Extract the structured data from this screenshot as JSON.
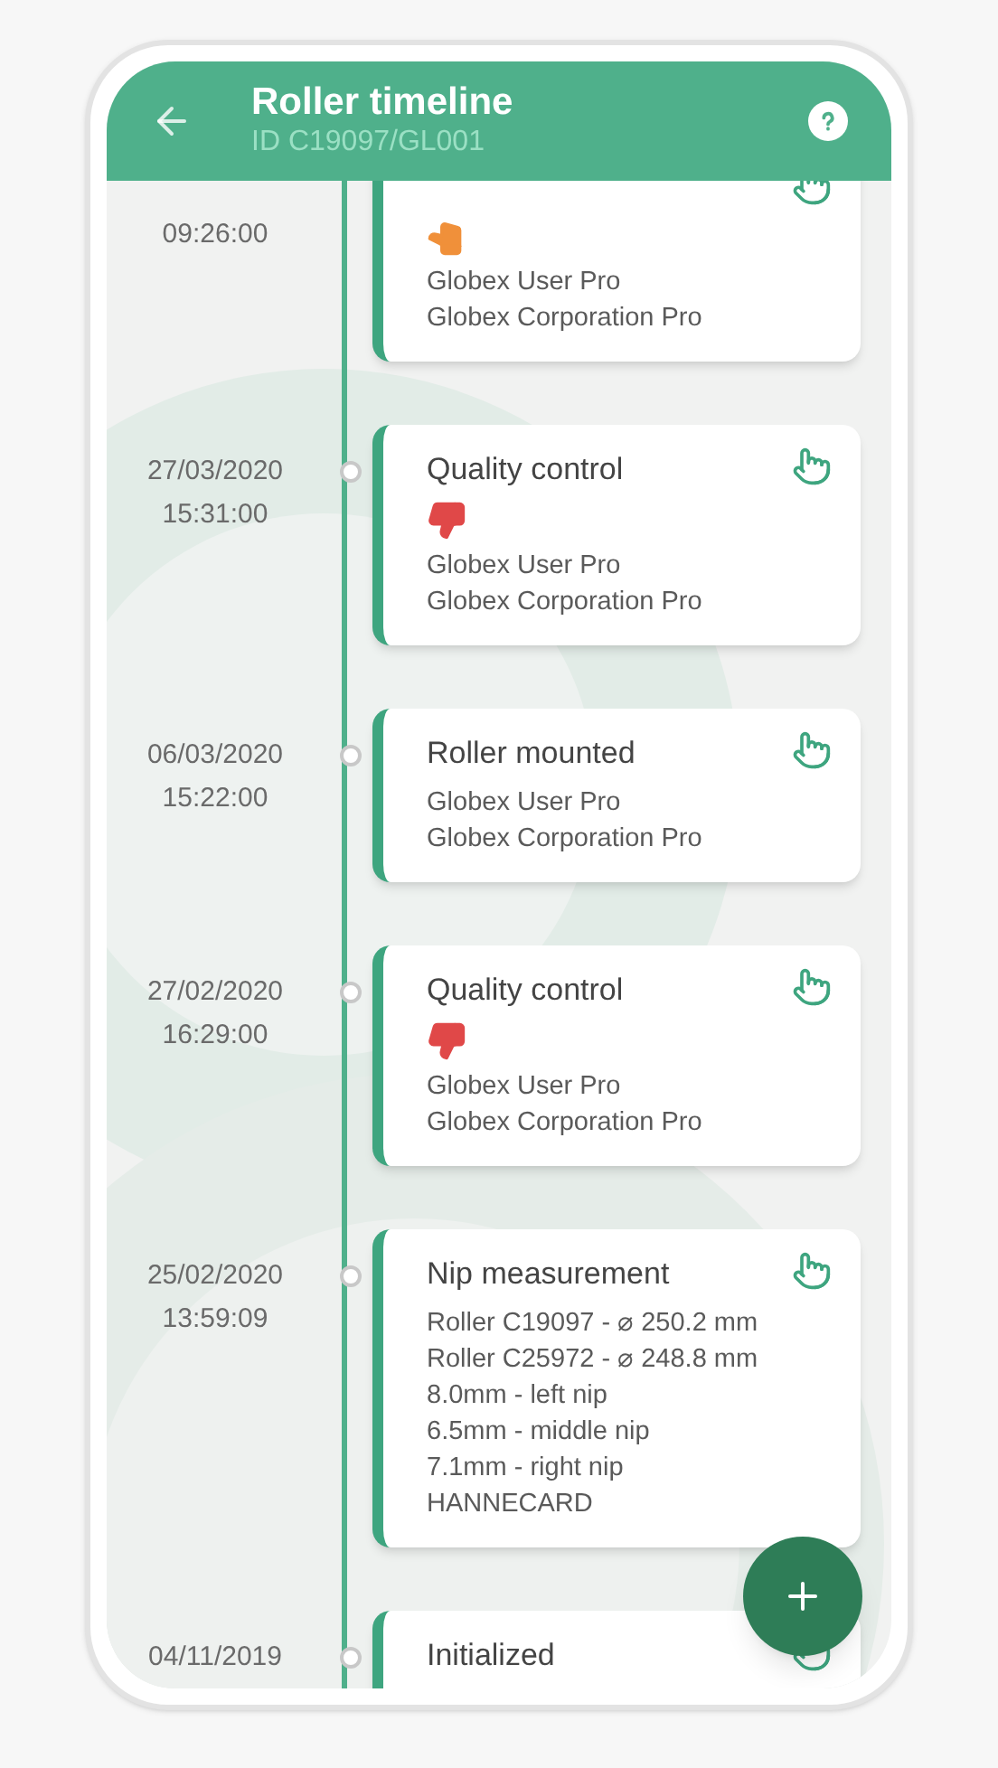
{
  "header": {
    "title": "Roller timeline",
    "subtitle": "ID C19097/GL001"
  },
  "events": [
    {
      "kind": "warning",
      "time": "09:26:00",
      "lines": [
        "Globex User Pro",
        "Globex Corporation Pro"
      ]
    },
    {
      "kind": "failed",
      "date": "27/03/2020",
      "time": "15:31:00",
      "title": "Quality control",
      "lines": [
        "Globex User Pro",
        "Globex Corporation Pro"
      ]
    },
    {
      "kind": "plain",
      "date": "06/03/2020",
      "time": "15:22:00",
      "title": "Roller mounted",
      "lines": [
        "Globex User Pro",
        "Globex Corporation Pro"
      ]
    },
    {
      "kind": "failed",
      "date": "27/02/2020",
      "time": "16:29:00",
      "title": "Quality control",
      "lines": [
        "Globex User Pro",
        "Globex Corporation Pro"
      ]
    },
    {
      "kind": "plain",
      "date": "25/02/2020",
      "time": "13:59:09",
      "title": "Nip measurement",
      "lines": [
        "Roller C19097 - ⌀ 250.2 mm",
        "Roller C25972 - ⌀ 248.8 mm",
        "8.0mm - left nip",
        "6.5mm - middle nip",
        "7.1mm - right nip",
        "HANNECARD"
      ]
    },
    {
      "kind": "plain",
      "date": "04/11/2019",
      "title": "Initialized"
    }
  ]
}
